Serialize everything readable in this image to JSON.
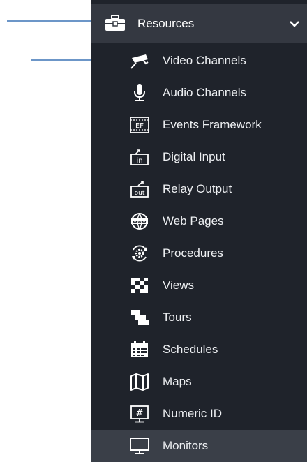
{
  "header": {
    "title": "Resources",
    "icon": "briefcase-icon",
    "expand_icon": "chevron-down-icon"
  },
  "items": [
    {
      "label": "Video Channels",
      "icon": "camera-icon"
    },
    {
      "label": "Audio Channels",
      "icon": "microphone-icon"
    },
    {
      "label": "Events Framework",
      "icon": "events-framework-icon",
      "icon_text": "EF"
    },
    {
      "label": "Digital Input",
      "icon": "digital-input-icon",
      "icon_text": "in"
    },
    {
      "label": "Relay Output",
      "icon": "relay-output-icon",
      "icon_text": "out"
    },
    {
      "label": "Web Pages",
      "icon": "globe-www-icon",
      "icon_text": "www"
    },
    {
      "label": "Procedures",
      "icon": "procedures-gear-icon"
    },
    {
      "label": "Views",
      "icon": "views-grid-icon"
    },
    {
      "label": "Tours",
      "icon": "tours-icon"
    },
    {
      "label": "Schedules",
      "icon": "calendar-icon"
    },
    {
      "label": "Maps",
      "icon": "map-icon"
    },
    {
      "label": "Numeric ID",
      "icon": "numeric-id-icon",
      "icon_text": "#"
    },
    {
      "label": "Monitors",
      "icon": "monitor-icon",
      "active": true
    }
  ],
  "colors": {
    "sidebar_bg": "#1f232b",
    "header_bg": "#343841",
    "active_bg": "#3a3f48",
    "text": "#eef0f3",
    "arrow": "#3c74b6"
  }
}
